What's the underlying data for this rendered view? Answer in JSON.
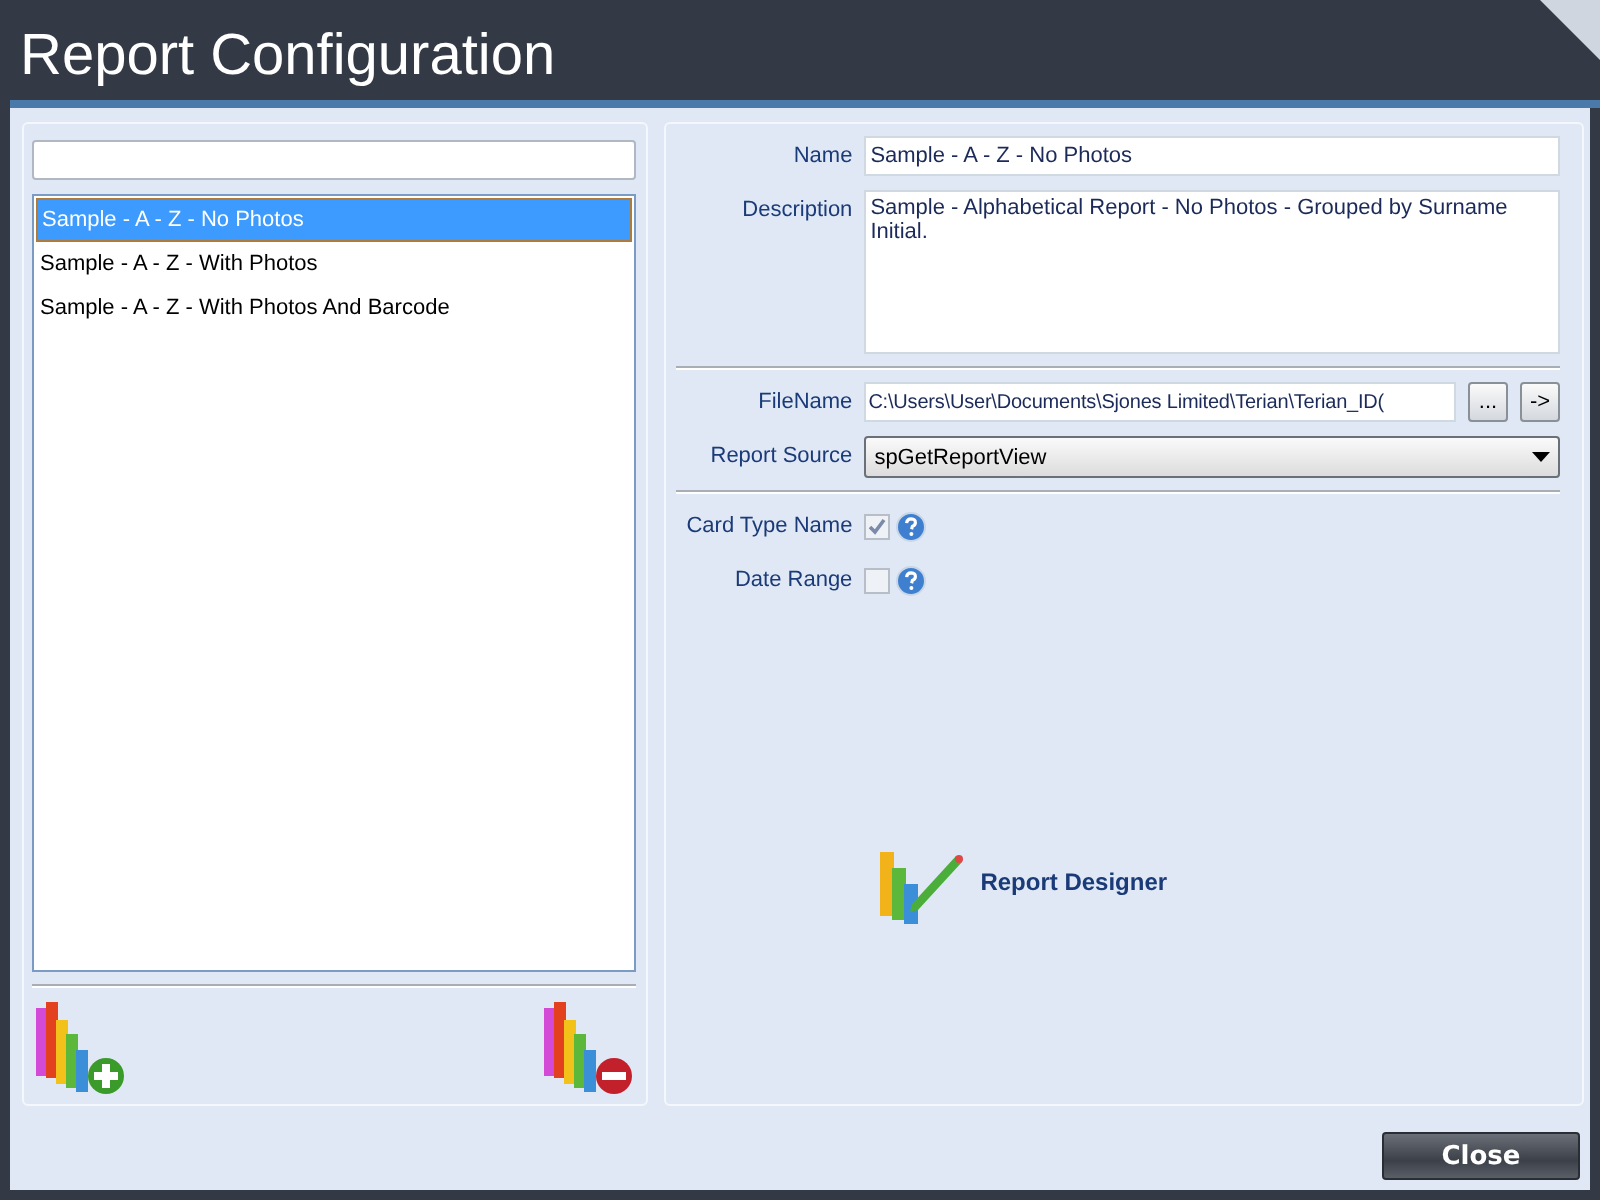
{
  "window": {
    "title": "Report Configuration"
  },
  "reports": [
    {
      "label": "Sample - A - Z - No Photos",
      "selected": true
    },
    {
      "label": "Sample - A - Z - With Photos",
      "selected": false
    },
    {
      "label": "Sample - A - Z - With Photos And Barcode",
      "selected": false
    }
  ],
  "details": {
    "name_label": "Name",
    "name_value": "Sample - A - Z - No Photos",
    "description_label": "Description",
    "description_value": "Sample - Alphabetical Report - No Photos - Grouped by Surname Initial.",
    "filename_label": "FileName",
    "filename_value": "C:\\Users\\User\\Documents\\Sjones Limited\\Terian\\Terian_ID(",
    "browse_button": "...",
    "go_button": "->",
    "source_label": "Report Source",
    "source_value": "spGetReportView"
  },
  "options": [
    {
      "label": "Card Type Name",
      "checked": true
    },
    {
      "label": "Date Range",
      "checked": false
    }
  ],
  "designer_button": "Report Designer",
  "buttons": [
    "Close"
  ]
}
